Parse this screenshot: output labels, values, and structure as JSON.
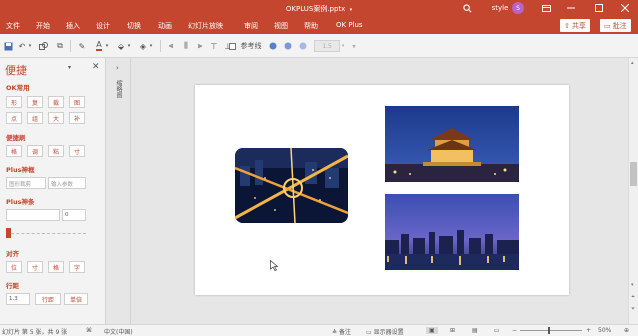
{
  "titlebar": {
    "title": "OKPLUS案例.pptx",
    "user": "style",
    "avatar_letter": "S"
  },
  "menubar": {
    "items": [
      "文件",
      "开始",
      "插入",
      "设计",
      "切换",
      "动画",
      "幻灯片放映",
      "审阅",
      "视图",
      "帮助",
      "OK Plus"
    ],
    "share_label": "共享",
    "comment_label": "批注"
  },
  "toolbar": {
    "checkbox_label": "参考线",
    "num_value": "1.5"
  },
  "pane": {
    "title": "便捷",
    "sections": {
      "ok_common": "OK常用",
      "quick_brush": "便捷刷",
      "plus_mask": "Plus神框",
      "plus_bar": "Plus神条",
      "align": "对齐",
      "line_spacing": "行距"
    },
    "ok_buttons_row1": [
      "形",
      "复",
      "裁",
      "图"
    ],
    "ok_buttons_row2": [
      "点",
      "组",
      "大",
      "补"
    ],
    "brush_buttons": [
      "格",
      "调",
      "粘",
      "寸"
    ],
    "mask_input1": "图形裁剪",
    "mask_input2": "输入参数",
    "bar_input_value": "0",
    "align_buttons": [
      "位",
      "寸",
      "格",
      "字"
    ],
    "spacing_value": "1.3",
    "spacing_btn1": "行距",
    "spacing_btn2": "单倍"
  },
  "thumbbar": {
    "label": "缩略图"
  },
  "status": {
    "slide_info": "幻灯片 第 5 张，共 9 张",
    "language": "中文(中国)",
    "notes": "备注",
    "display_settings": "显示器设置",
    "zoom": "50%"
  },
  "colors": {
    "accent": "#c5462f",
    "toolbar_bg": "#f3f3f3",
    "canvas_bg": "#e6e6e6"
  }
}
